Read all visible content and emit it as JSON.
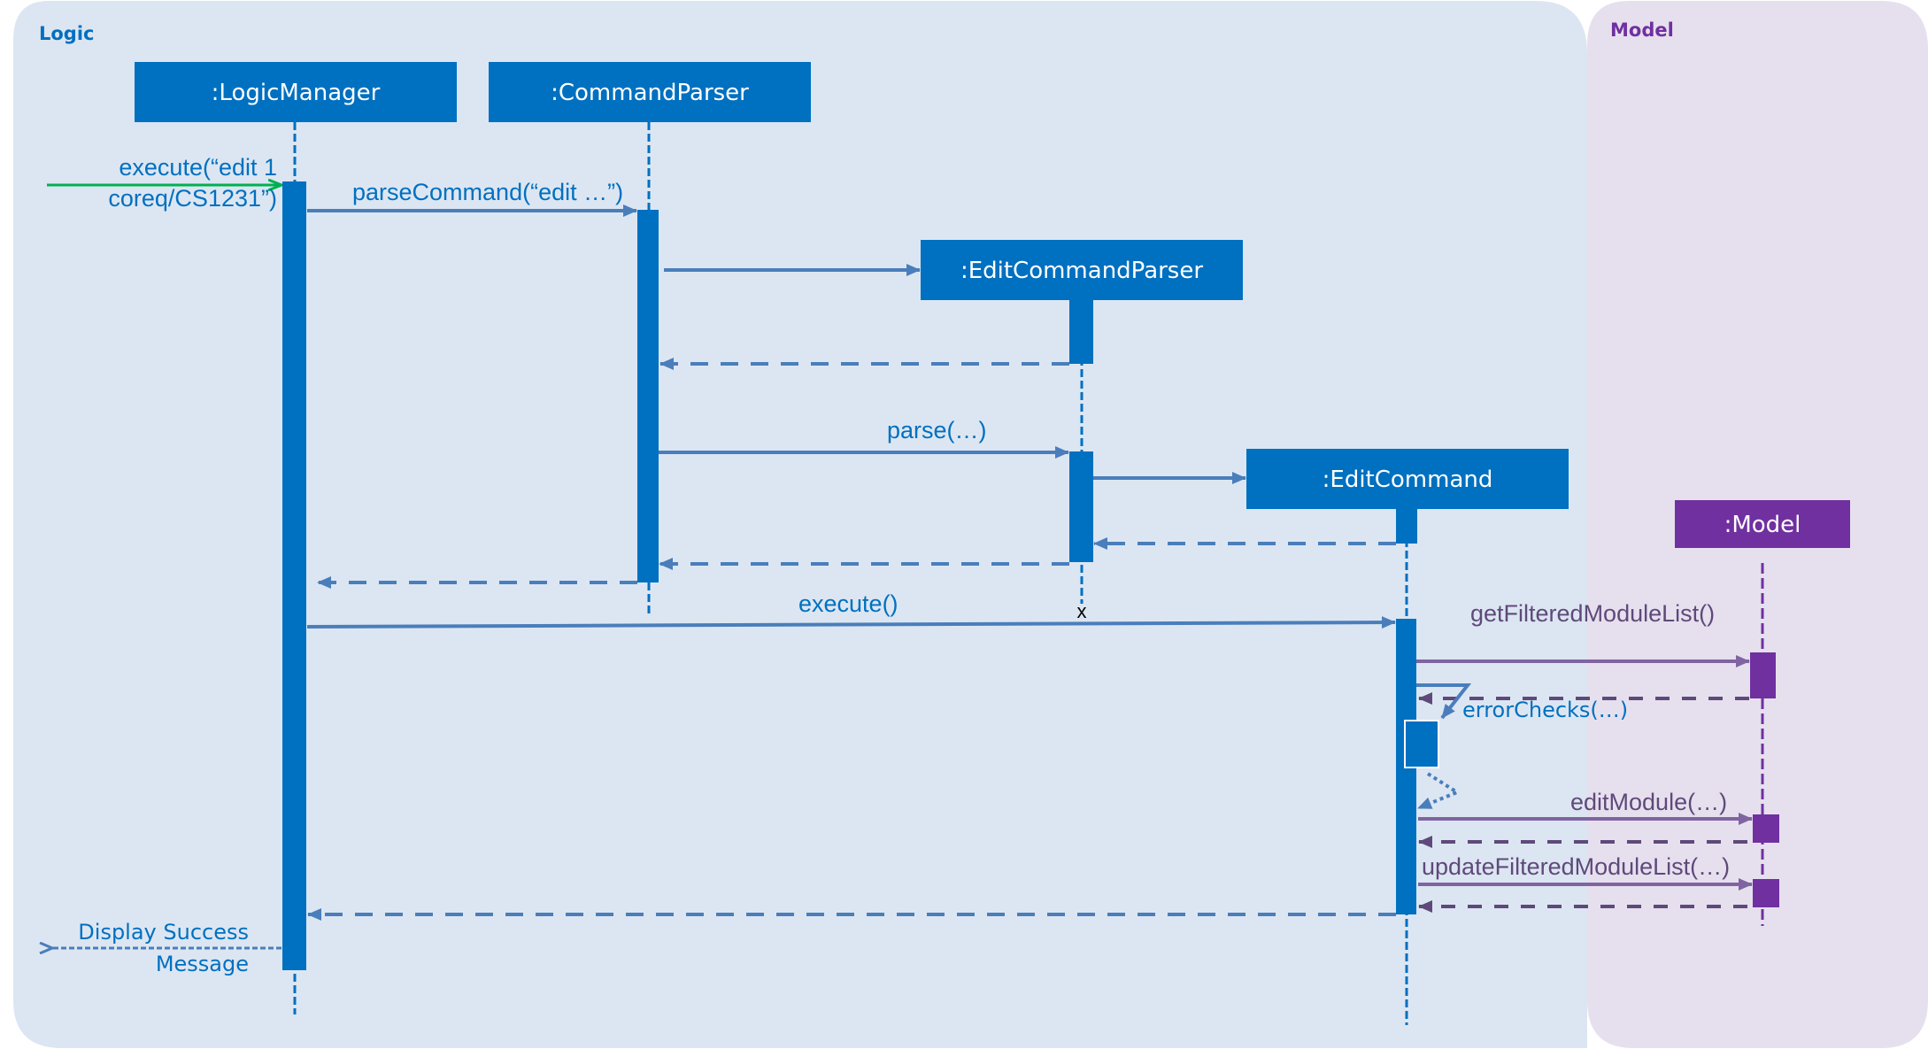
{
  "colors": {
    "logic_panel": "#dce6f2",
    "model_panel": "#e6e0ee",
    "logic_accent": "#0070c0",
    "arrow_blue": "#4a7ebb",
    "model_accent": "#7030a0",
    "model_arrow": "#8064a2",
    "model_return": "#5f497a",
    "found_message": "#00b050"
  },
  "packages": {
    "logic": "Logic",
    "model": "Model"
  },
  "participants": {
    "logic_manager": ":LogicManager",
    "command_parser": ":CommandParser",
    "edit_command_parser": ":EditCommandParser",
    "edit_command": ":EditCommand",
    "model": ":Model"
  },
  "messages": {
    "execute_line1": "execute(“edit 1",
    "execute_line2": "coreq/CS1231”)",
    "parse_command": "parseCommand(“edit …”)",
    "parse": "parse(…)",
    "execute": "execute()",
    "destroy_marker": "x",
    "get_filtered_module_list": "getFilteredModuleList()",
    "error_checks": "errorChecks(…)",
    "edit_module": "editModule(…)",
    "update_filtered_module_list": "updateFilteredModuleList(…)",
    "display_line1": "Display Success",
    "display_line2": "Message"
  }
}
